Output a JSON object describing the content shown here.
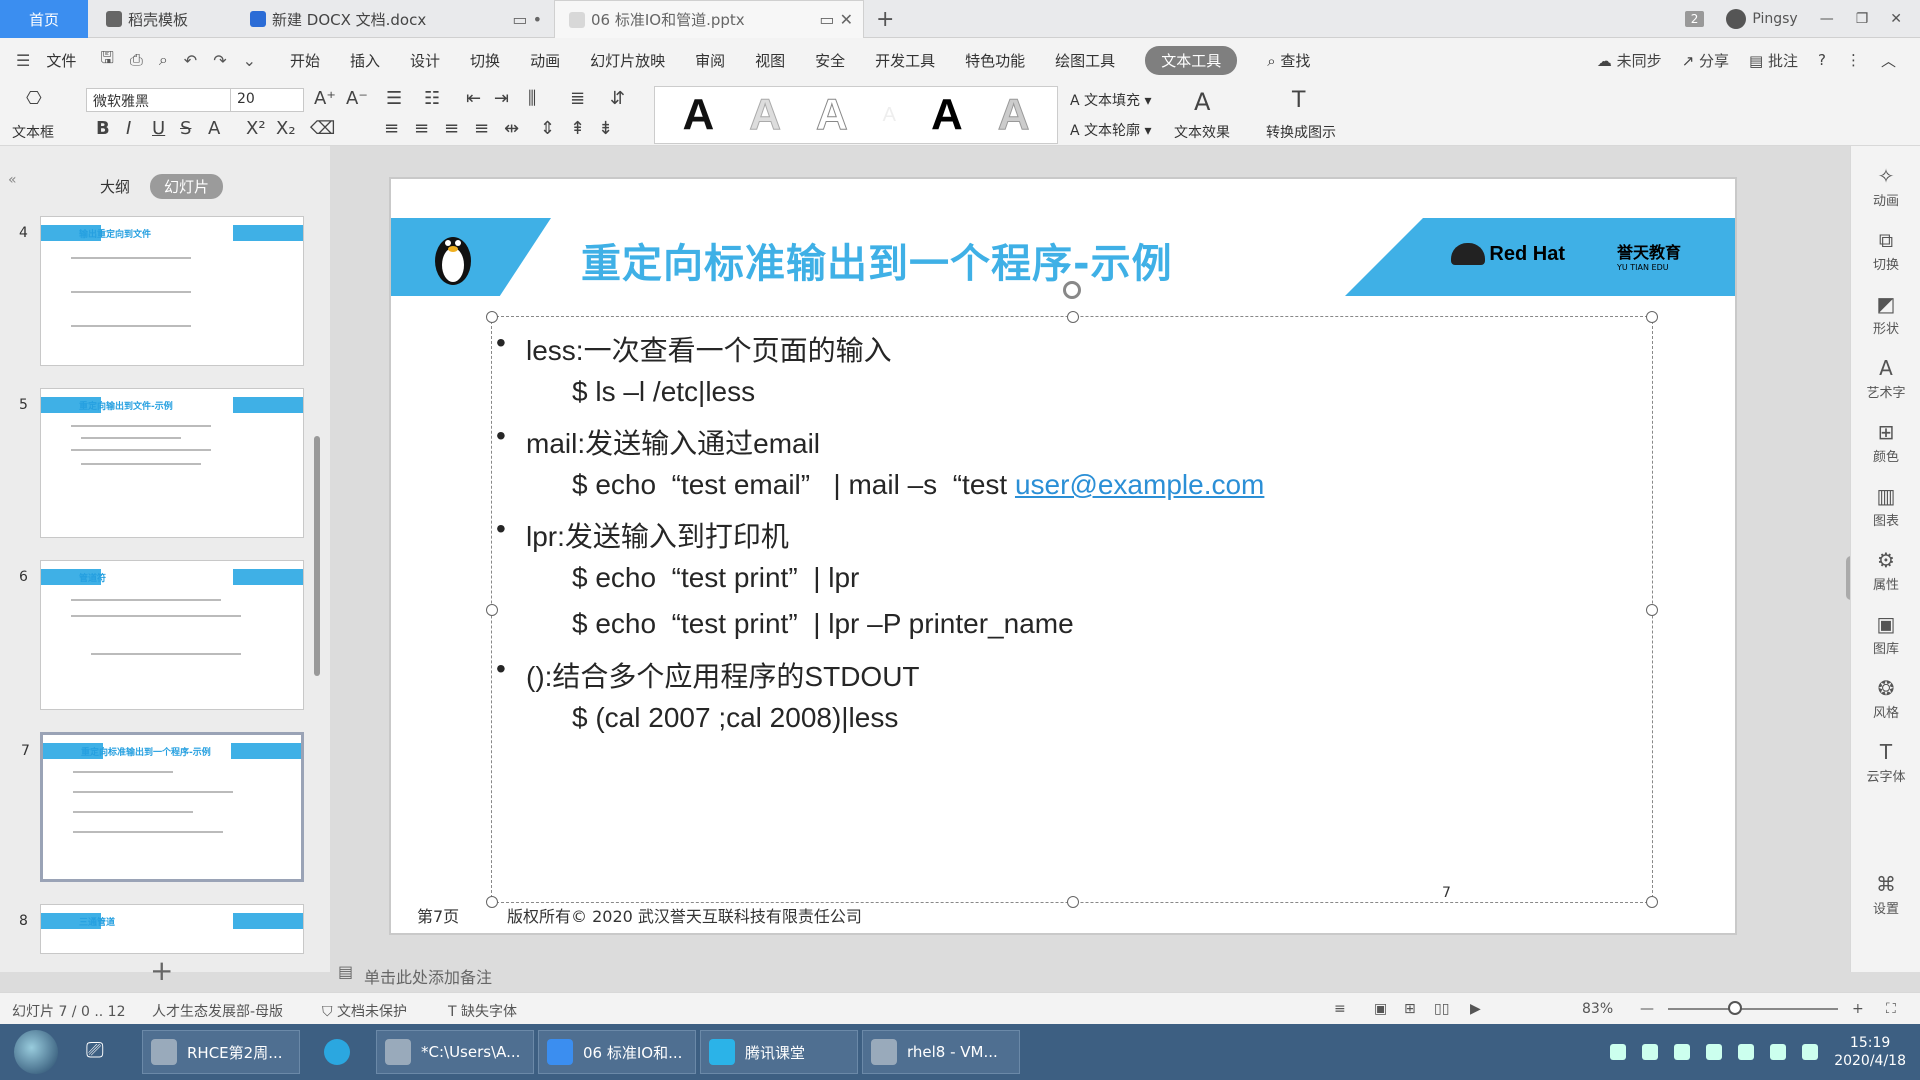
{
  "tabs": {
    "home": "首页",
    "daoke": "稻壳模板",
    "docx": "新建 DOCX 文档.docx",
    "pptx": "06 标准IO和管道.pptx"
  },
  "window": {
    "badge": "2",
    "user": "Pingsy"
  },
  "menu": {
    "file": "文件",
    "items": [
      "开始",
      "插入",
      "设计",
      "切换",
      "动画",
      "幻灯片放映",
      "审阅",
      "视图",
      "安全",
      "开发工具",
      "特色功能",
      "绘图工具",
      "文本工具"
    ],
    "search": "查找",
    "sync": "未同步",
    "share": "分享",
    "comment": "批注"
  },
  "ribbon": {
    "textbox": "文本框",
    "font": "微软雅黑",
    "size": "20",
    "fill": "文本填充",
    "outline": "文本轮廓",
    "effect": "文本效果",
    "convert": "转换成图示",
    "wordart": [
      "A",
      "A",
      "A",
      "A",
      "A",
      "A"
    ]
  },
  "panel": {
    "outline": "大纲",
    "slides": "幻灯片",
    "thumbs": [
      {
        "num": "4",
        "title": "输出重定向到文件"
      },
      {
        "num": "5",
        "title": "重定向输出到文件-示例"
      },
      {
        "num": "6",
        "title": "管道符"
      },
      {
        "num": "7",
        "title": "重定向标准输出到一个程序-示例"
      },
      {
        "num": "8",
        "title": "三通管道"
      }
    ]
  },
  "slide": {
    "title": "重定向标准输出到一个程序-示例",
    "logo_rh": "Red Hat",
    "logo_yt": "誉天教育",
    "logo_yt_en": "YU TIAN EDU",
    "items": [
      {
        "bullet": "less:一次查看一个页面的输入",
        "cmds": [
          "$ ls –l /etc|less"
        ]
      },
      {
        "bullet": "mail:发送输入通过email",
        "cmds": [
          "$ echo  “test email”   | mail –s  “test "
        ],
        "link": "user@example.com"
      },
      {
        "bullet": "lpr:发送输入到打印机",
        "cmds": [
          "$ echo  “test print”  | lpr",
          "$ echo  “test print”  | lpr –P printer_name"
        ]
      },
      {
        "bullet": "():结合多个应用程序的STDOUT",
        "cmds": [
          "$ (cal 2007 ;cal 2008)|less"
        ]
      }
    ],
    "footer_page": "第7页",
    "footer_copyright": "版权所有© 2020 武汉誉天互联科技有限责任公司",
    "footer_num": "7"
  },
  "notes": "单击此处添加备注",
  "rightpane": [
    "动画",
    "切换",
    "形状",
    "艺术字",
    "颜色",
    "图表",
    "属性",
    "图库",
    "风格",
    "云字体",
    "设置"
  ],
  "status": {
    "slide": "幻灯片 7 / 0 .. 12",
    "theme": "人才生态发展部-母版",
    "protect": "文档未保护",
    "font": "缺失字体",
    "zoom": "83%"
  },
  "taskbar": {
    "items": [
      "RHCE第2周...",
      "*C:\\Users\\A...",
      "06 标准IO和...",
      "腾讯课堂",
      "rhel8 - VM..."
    ],
    "time": "15:19",
    "date": "2020/4/18"
  }
}
